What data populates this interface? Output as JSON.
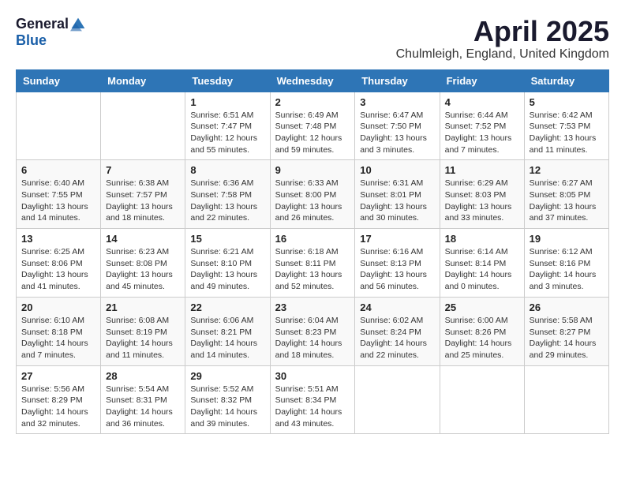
{
  "header": {
    "logo_general": "General",
    "logo_blue": "Blue",
    "title": "April 2025",
    "location": "Chulmleigh, England, United Kingdom"
  },
  "columns": [
    "Sunday",
    "Monday",
    "Tuesday",
    "Wednesday",
    "Thursday",
    "Friday",
    "Saturday"
  ],
  "weeks": [
    [
      {
        "day": "",
        "info": ""
      },
      {
        "day": "",
        "info": ""
      },
      {
        "day": "1",
        "info": "Sunrise: 6:51 AM\nSunset: 7:47 PM\nDaylight: 12 hours and 55 minutes."
      },
      {
        "day": "2",
        "info": "Sunrise: 6:49 AM\nSunset: 7:48 PM\nDaylight: 12 hours and 59 minutes."
      },
      {
        "day": "3",
        "info": "Sunrise: 6:47 AM\nSunset: 7:50 PM\nDaylight: 13 hours and 3 minutes."
      },
      {
        "day": "4",
        "info": "Sunrise: 6:44 AM\nSunset: 7:52 PM\nDaylight: 13 hours and 7 minutes."
      },
      {
        "day": "5",
        "info": "Sunrise: 6:42 AM\nSunset: 7:53 PM\nDaylight: 13 hours and 11 minutes."
      }
    ],
    [
      {
        "day": "6",
        "info": "Sunrise: 6:40 AM\nSunset: 7:55 PM\nDaylight: 13 hours and 14 minutes."
      },
      {
        "day": "7",
        "info": "Sunrise: 6:38 AM\nSunset: 7:57 PM\nDaylight: 13 hours and 18 minutes."
      },
      {
        "day": "8",
        "info": "Sunrise: 6:36 AM\nSunset: 7:58 PM\nDaylight: 13 hours and 22 minutes."
      },
      {
        "day": "9",
        "info": "Sunrise: 6:33 AM\nSunset: 8:00 PM\nDaylight: 13 hours and 26 minutes."
      },
      {
        "day": "10",
        "info": "Sunrise: 6:31 AM\nSunset: 8:01 PM\nDaylight: 13 hours and 30 minutes."
      },
      {
        "day": "11",
        "info": "Sunrise: 6:29 AM\nSunset: 8:03 PM\nDaylight: 13 hours and 33 minutes."
      },
      {
        "day": "12",
        "info": "Sunrise: 6:27 AM\nSunset: 8:05 PM\nDaylight: 13 hours and 37 minutes."
      }
    ],
    [
      {
        "day": "13",
        "info": "Sunrise: 6:25 AM\nSunset: 8:06 PM\nDaylight: 13 hours and 41 minutes."
      },
      {
        "day": "14",
        "info": "Sunrise: 6:23 AM\nSunset: 8:08 PM\nDaylight: 13 hours and 45 minutes."
      },
      {
        "day": "15",
        "info": "Sunrise: 6:21 AM\nSunset: 8:10 PM\nDaylight: 13 hours and 49 minutes."
      },
      {
        "day": "16",
        "info": "Sunrise: 6:18 AM\nSunset: 8:11 PM\nDaylight: 13 hours and 52 minutes."
      },
      {
        "day": "17",
        "info": "Sunrise: 6:16 AM\nSunset: 8:13 PM\nDaylight: 13 hours and 56 minutes."
      },
      {
        "day": "18",
        "info": "Sunrise: 6:14 AM\nSunset: 8:14 PM\nDaylight: 14 hours and 0 minutes."
      },
      {
        "day": "19",
        "info": "Sunrise: 6:12 AM\nSunset: 8:16 PM\nDaylight: 14 hours and 3 minutes."
      }
    ],
    [
      {
        "day": "20",
        "info": "Sunrise: 6:10 AM\nSunset: 8:18 PM\nDaylight: 14 hours and 7 minutes."
      },
      {
        "day": "21",
        "info": "Sunrise: 6:08 AM\nSunset: 8:19 PM\nDaylight: 14 hours and 11 minutes."
      },
      {
        "day": "22",
        "info": "Sunrise: 6:06 AM\nSunset: 8:21 PM\nDaylight: 14 hours and 14 minutes."
      },
      {
        "day": "23",
        "info": "Sunrise: 6:04 AM\nSunset: 8:23 PM\nDaylight: 14 hours and 18 minutes."
      },
      {
        "day": "24",
        "info": "Sunrise: 6:02 AM\nSunset: 8:24 PM\nDaylight: 14 hours and 22 minutes."
      },
      {
        "day": "25",
        "info": "Sunrise: 6:00 AM\nSunset: 8:26 PM\nDaylight: 14 hours and 25 minutes."
      },
      {
        "day": "26",
        "info": "Sunrise: 5:58 AM\nSunset: 8:27 PM\nDaylight: 14 hours and 29 minutes."
      }
    ],
    [
      {
        "day": "27",
        "info": "Sunrise: 5:56 AM\nSunset: 8:29 PM\nDaylight: 14 hours and 32 minutes."
      },
      {
        "day": "28",
        "info": "Sunrise: 5:54 AM\nSunset: 8:31 PM\nDaylight: 14 hours and 36 minutes."
      },
      {
        "day": "29",
        "info": "Sunrise: 5:52 AM\nSunset: 8:32 PM\nDaylight: 14 hours and 39 minutes."
      },
      {
        "day": "30",
        "info": "Sunrise: 5:51 AM\nSunset: 8:34 PM\nDaylight: 14 hours and 43 minutes."
      },
      {
        "day": "",
        "info": ""
      },
      {
        "day": "",
        "info": ""
      },
      {
        "day": "",
        "info": ""
      }
    ]
  ]
}
